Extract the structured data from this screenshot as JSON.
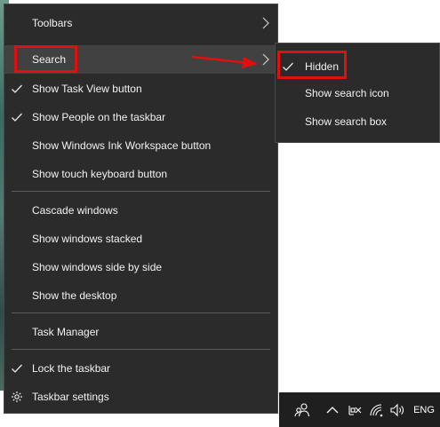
{
  "main_menu": {
    "items": [
      {
        "label": "Toolbars",
        "checked": false,
        "submenu": true
      },
      {
        "label": "Search",
        "checked": false,
        "submenu": true,
        "highlighted": true
      },
      {
        "label": "Show Task View button",
        "checked": true
      },
      {
        "label": "Show People on the taskbar",
        "checked": true
      },
      {
        "label": "Show Windows Ink Workspace button",
        "checked": false
      },
      {
        "label": "Show touch keyboard button",
        "checked": false
      },
      {
        "label": "Cascade windows",
        "checked": false
      },
      {
        "label": "Show windows stacked",
        "checked": false
      },
      {
        "label": "Show windows side by side",
        "checked": false
      },
      {
        "label": "Show the desktop",
        "checked": false
      },
      {
        "label": "Task Manager",
        "checked": false
      },
      {
        "label": "Lock the taskbar",
        "checked": true
      },
      {
        "label": "Taskbar settings",
        "icon": "gear-icon"
      }
    ]
  },
  "search_submenu": {
    "items": [
      {
        "label": "Hidden",
        "checked": true
      },
      {
        "label": "Show search icon",
        "checked": false
      },
      {
        "label": "Show search box",
        "checked": false
      }
    ]
  },
  "taskbar": {
    "tray_icons": [
      "people-icon",
      "chevron-up-icon",
      "network-disconnected-icon",
      "wifi-icon",
      "volume-icon"
    ],
    "language": "ENG"
  },
  "colors": {
    "menu_bg": "#2b2b2b",
    "menu_hover": "#414141",
    "menu_text": "#f2f2f2",
    "annotation": "#e01010",
    "taskbar_bg": "#1f1f1f"
  }
}
